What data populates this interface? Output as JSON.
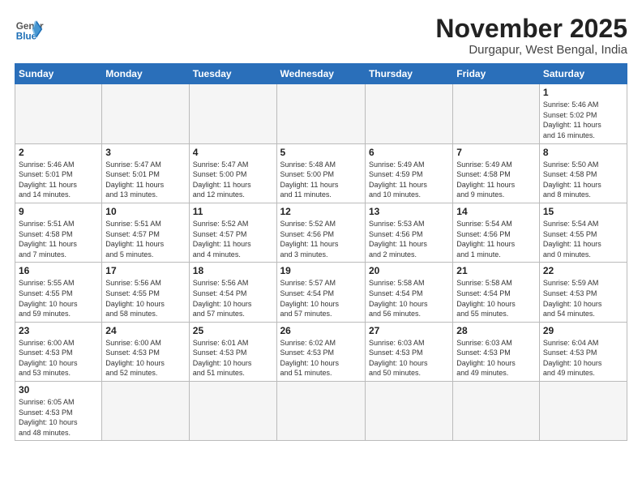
{
  "header": {
    "logo_general": "General",
    "logo_blue": "Blue",
    "title": "November 2025",
    "subtitle": "Durgapur, West Bengal, India"
  },
  "days_of_week": [
    "Sunday",
    "Monday",
    "Tuesday",
    "Wednesday",
    "Thursday",
    "Friday",
    "Saturday"
  ],
  "weeks": [
    [
      {
        "day": "",
        "info": ""
      },
      {
        "day": "",
        "info": ""
      },
      {
        "day": "",
        "info": ""
      },
      {
        "day": "",
        "info": ""
      },
      {
        "day": "",
        "info": ""
      },
      {
        "day": "",
        "info": ""
      },
      {
        "day": "1",
        "info": "Sunrise: 5:46 AM\nSunset: 5:02 PM\nDaylight: 11 hours\nand 16 minutes."
      }
    ],
    [
      {
        "day": "2",
        "info": "Sunrise: 5:46 AM\nSunset: 5:01 PM\nDaylight: 11 hours\nand 14 minutes."
      },
      {
        "day": "3",
        "info": "Sunrise: 5:47 AM\nSunset: 5:01 PM\nDaylight: 11 hours\nand 13 minutes."
      },
      {
        "day": "4",
        "info": "Sunrise: 5:47 AM\nSunset: 5:00 PM\nDaylight: 11 hours\nand 12 minutes."
      },
      {
        "day": "5",
        "info": "Sunrise: 5:48 AM\nSunset: 5:00 PM\nDaylight: 11 hours\nand 11 minutes."
      },
      {
        "day": "6",
        "info": "Sunrise: 5:49 AM\nSunset: 4:59 PM\nDaylight: 11 hours\nand 10 minutes."
      },
      {
        "day": "7",
        "info": "Sunrise: 5:49 AM\nSunset: 4:58 PM\nDaylight: 11 hours\nand 9 minutes."
      },
      {
        "day": "8",
        "info": "Sunrise: 5:50 AM\nSunset: 4:58 PM\nDaylight: 11 hours\nand 8 minutes."
      }
    ],
    [
      {
        "day": "9",
        "info": "Sunrise: 5:51 AM\nSunset: 4:58 PM\nDaylight: 11 hours\nand 7 minutes."
      },
      {
        "day": "10",
        "info": "Sunrise: 5:51 AM\nSunset: 4:57 PM\nDaylight: 11 hours\nand 5 minutes."
      },
      {
        "day": "11",
        "info": "Sunrise: 5:52 AM\nSunset: 4:57 PM\nDaylight: 11 hours\nand 4 minutes."
      },
      {
        "day": "12",
        "info": "Sunrise: 5:52 AM\nSunset: 4:56 PM\nDaylight: 11 hours\nand 3 minutes."
      },
      {
        "day": "13",
        "info": "Sunrise: 5:53 AM\nSunset: 4:56 PM\nDaylight: 11 hours\nand 2 minutes."
      },
      {
        "day": "14",
        "info": "Sunrise: 5:54 AM\nSunset: 4:56 PM\nDaylight: 11 hours\nand 1 minute."
      },
      {
        "day": "15",
        "info": "Sunrise: 5:54 AM\nSunset: 4:55 PM\nDaylight: 11 hours\nand 0 minutes."
      }
    ],
    [
      {
        "day": "16",
        "info": "Sunrise: 5:55 AM\nSunset: 4:55 PM\nDaylight: 10 hours\nand 59 minutes."
      },
      {
        "day": "17",
        "info": "Sunrise: 5:56 AM\nSunset: 4:55 PM\nDaylight: 10 hours\nand 58 minutes."
      },
      {
        "day": "18",
        "info": "Sunrise: 5:56 AM\nSunset: 4:54 PM\nDaylight: 10 hours\nand 57 minutes."
      },
      {
        "day": "19",
        "info": "Sunrise: 5:57 AM\nSunset: 4:54 PM\nDaylight: 10 hours\nand 57 minutes."
      },
      {
        "day": "20",
        "info": "Sunrise: 5:58 AM\nSunset: 4:54 PM\nDaylight: 10 hours\nand 56 minutes."
      },
      {
        "day": "21",
        "info": "Sunrise: 5:58 AM\nSunset: 4:54 PM\nDaylight: 10 hours\nand 55 minutes."
      },
      {
        "day": "22",
        "info": "Sunrise: 5:59 AM\nSunset: 4:53 PM\nDaylight: 10 hours\nand 54 minutes."
      }
    ],
    [
      {
        "day": "23",
        "info": "Sunrise: 6:00 AM\nSunset: 4:53 PM\nDaylight: 10 hours\nand 53 minutes."
      },
      {
        "day": "24",
        "info": "Sunrise: 6:00 AM\nSunset: 4:53 PM\nDaylight: 10 hours\nand 52 minutes."
      },
      {
        "day": "25",
        "info": "Sunrise: 6:01 AM\nSunset: 4:53 PM\nDaylight: 10 hours\nand 51 minutes."
      },
      {
        "day": "26",
        "info": "Sunrise: 6:02 AM\nSunset: 4:53 PM\nDaylight: 10 hours\nand 51 minutes."
      },
      {
        "day": "27",
        "info": "Sunrise: 6:03 AM\nSunset: 4:53 PM\nDaylight: 10 hours\nand 50 minutes."
      },
      {
        "day": "28",
        "info": "Sunrise: 6:03 AM\nSunset: 4:53 PM\nDaylight: 10 hours\nand 49 minutes."
      },
      {
        "day": "29",
        "info": "Sunrise: 6:04 AM\nSunset: 4:53 PM\nDaylight: 10 hours\nand 49 minutes."
      }
    ],
    [
      {
        "day": "30",
        "info": "Sunrise: 6:05 AM\nSunset: 4:53 PM\nDaylight: 10 hours\nand 48 minutes."
      },
      {
        "day": "",
        "info": ""
      },
      {
        "day": "",
        "info": ""
      },
      {
        "day": "",
        "info": ""
      },
      {
        "day": "",
        "info": ""
      },
      {
        "day": "",
        "info": ""
      },
      {
        "day": "",
        "info": ""
      }
    ]
  ]
}
